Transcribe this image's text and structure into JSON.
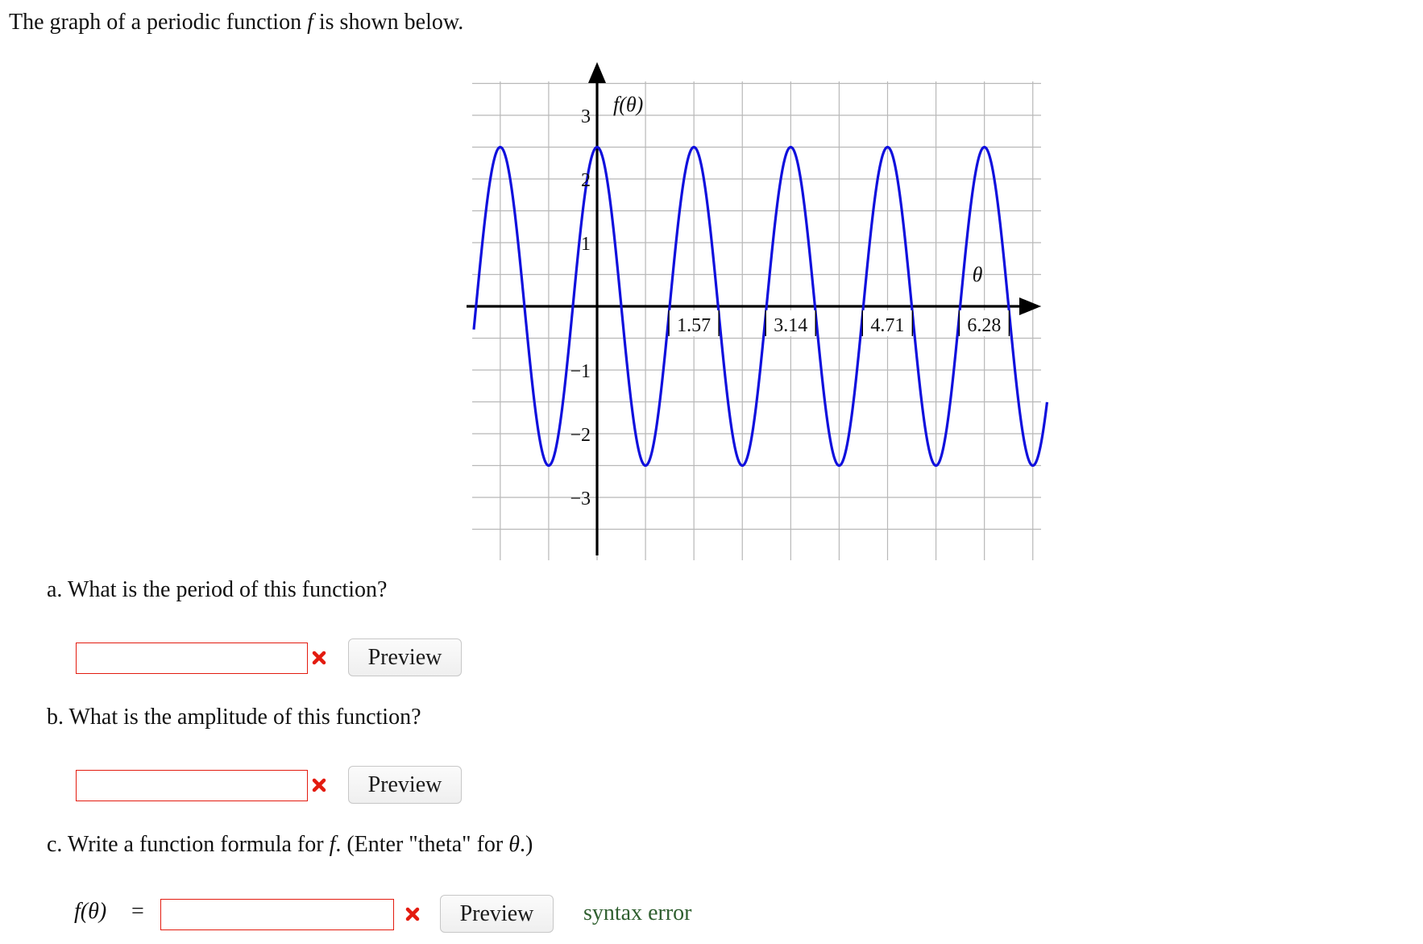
{
  "intro": {
    "before": "The graph of a periodic function ",
    "func": "f",
    "after": " is shown below."
  },
  "chart_data": {
    "type": "line",
    "title": "",
    "ylabel": "f(θ)",
    "xlabel": "θ",
    "xlim": [
      -2.5,
      9.3
    ],
    "ylim": [
      -3.8,
      3.5
    ],
    "xticks": [
      1.57,
      3.14,
      4.71,
      6.28
    ],
    "xtick_labels": [
      "1.57",
      "3.14",
      "4.71",
      "6.28"
    ],
    "yticks": [
      3,
      2,
      1,
      -1,
      -2,
      -3
    ],
    "ytick_labels": [
      "3",
      "2",
      "1",
      "−1",
      "−2",
      "−3"
    ],
    "grid": true,
    "series": [
      {
        "color": "#1010dd",
        "function": "2.5*cos(4*theta)",
        "amplitude": 2.5,
        "period": 1.5708,
        "x_range": [
          -2.0,
          7.3
        ]
      }
    ]
  },
  "questions": {
    "a": {
      "text": "a. What is the period of this function?",
      "value": "",
      "preview": "Preview"
    },
    "b": {
      "text": "b. What is the amplitude of this function?",
      "value": "",
      "preview": "Preview"
    },
    "c": {
      "text_before": "c. Write a function formula for ",
      "func": "f",
      "text_mid": ". (Enter \"theta\" for ",
      "var": "θ",
      "text_after": ".)",
      "lhs": "f(θ)",
      "equals": "=",
      "value": "",
      "preview": "Preview",
      "status": "syntax error"
    }
  },
  "colors": {
    "error_border": "#e31b0f",
    "curve": "#1010dd",
    "status": "#2f5f2f"
  }
}
